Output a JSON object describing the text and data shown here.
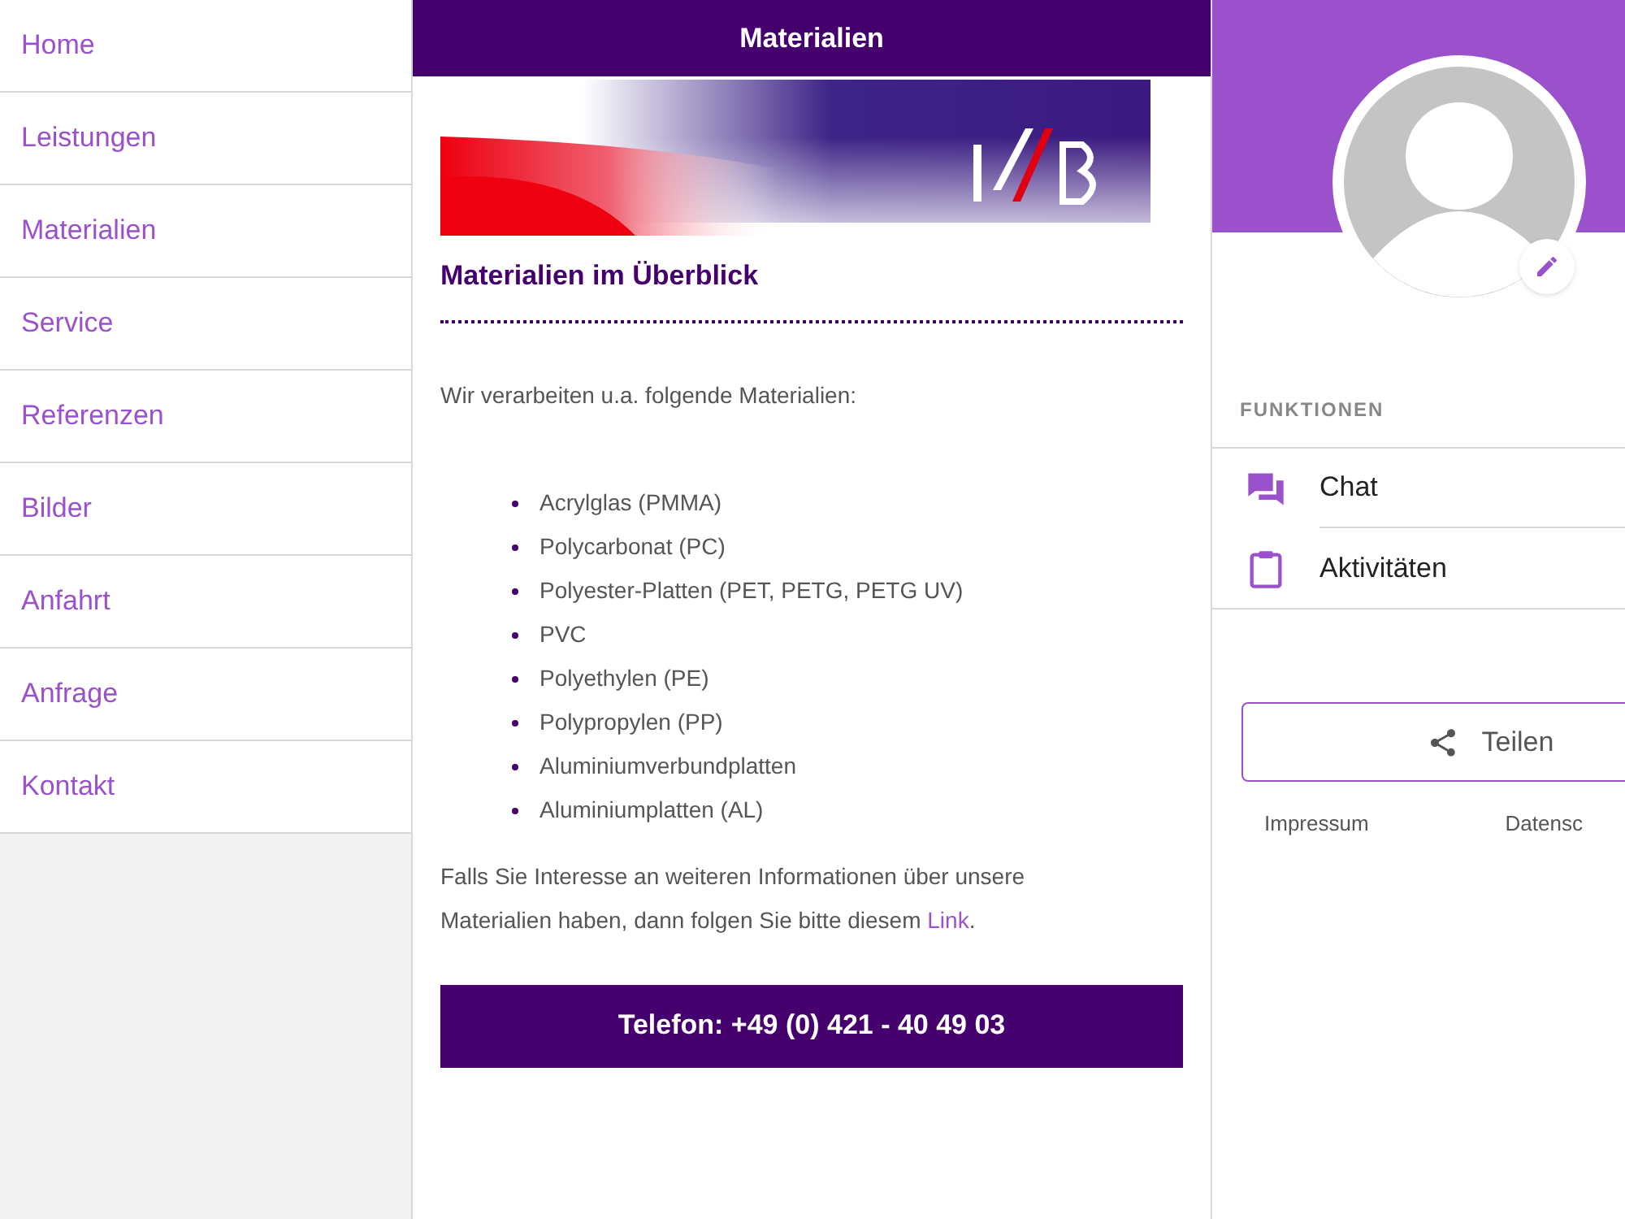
{
  "sidebar": {
    "items": [
      {
        "label": "Home"
      },
      {
        "label": "Leistungen"
      },
      {
        "label": "Materialien"
      },
      {
        "label": "Service"
      },
      {
        "label": "Referenzen"
      },
      {
        "label": "Bilder"
      },
      {
        "label": "Anfahrt"
      },
      {
        "label": "Anfrage"
      },
      {
        "label": "Kontakt"
      }
    ]
  },
  "main": {
    "title": "Materialien",
    "heading": "Materialien im Überblick",
    "intro": "Wir verarbeiten u.a. folgende Materialien:",
    "materials": [
      "Acrylglas (PMMA)",
      "Polycarbonat (PC)",
      "Polyester-Platten (PET, PETG, PETG UV)",
      "PVC",
      "Polyethylen (PE)",
      "Polypropylen (PP)",
      "Aluminiumverbundplatten",
      "Aluminiumplatten (AL)"
    ],
    "closing": "Falls Sie Interesse an weiteren Informationen über unsere Materialien haben, dann folgen Sie bitte diesem",
    "closing_link": "Link",
    "closing_end": ".",
    "phone_button": "Telefon: +49 (0) 421 - 40 49 03"
  },
  "profile": {
    "section_title": "FUNKTIONEN",
    "functions": [
      {
        "kind": "chat",
        "label": "Chat"
      },
      {
        "kind": "activities",
        "label": "Aktivitäten"
      }
    ],
    "share_button": "Teilen",
    "footer_links": [
      "Impressum",
      "Datensc"
    ]
  }
}
